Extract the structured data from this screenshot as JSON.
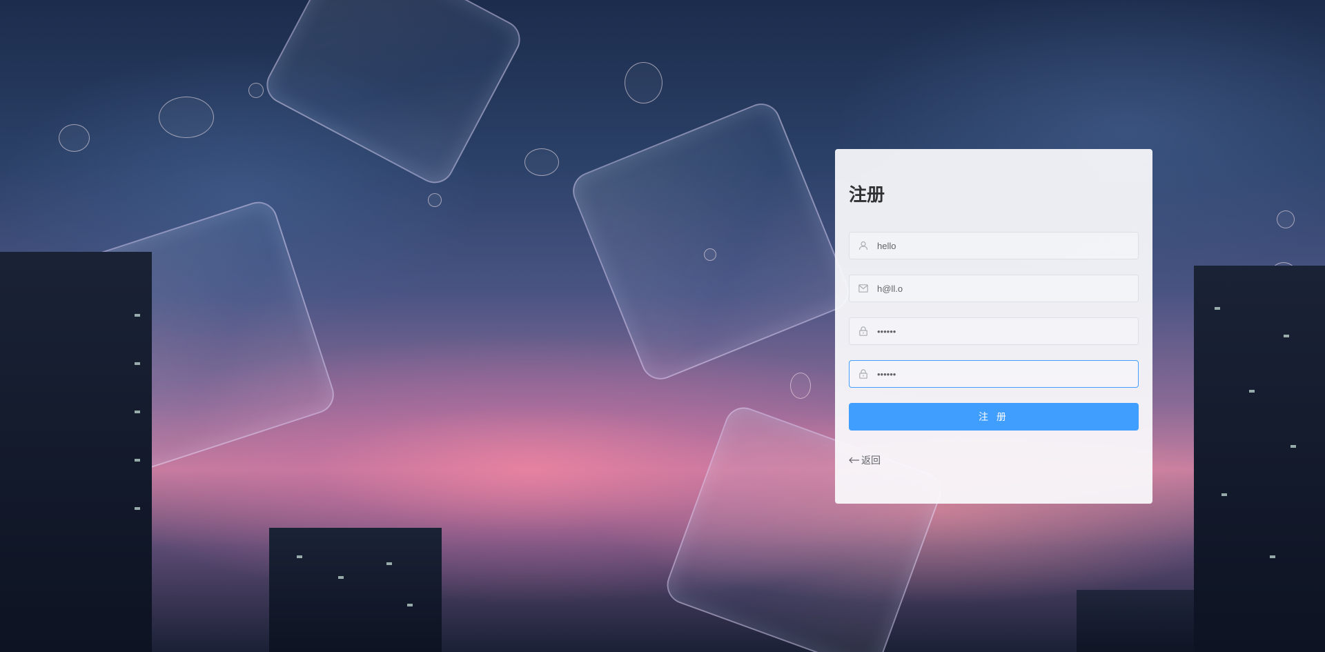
{
  "register": {
    "title": "注册",
    "username": {
      "value": "hello",
      "icon": "user-icon"
    },
    "email": {
      "value": "h@ll.o",
      "icon": "mail-icon"
    },
    "password": {
      "value": "••••••",
      "icon": "lock-icon"
    },
    "confirm_password": {
      "value": "••••••",
      "icon": "lock-icon"
    },
    "submit_label": "注 册",
    "back_label": "返回",
    "back_icon": "arrow-left-icon"
  },
  "colors": {
    "accent": "#409eff",
    "text": "#303133",
    "placeholder": "#a8abb2"
  }
}
